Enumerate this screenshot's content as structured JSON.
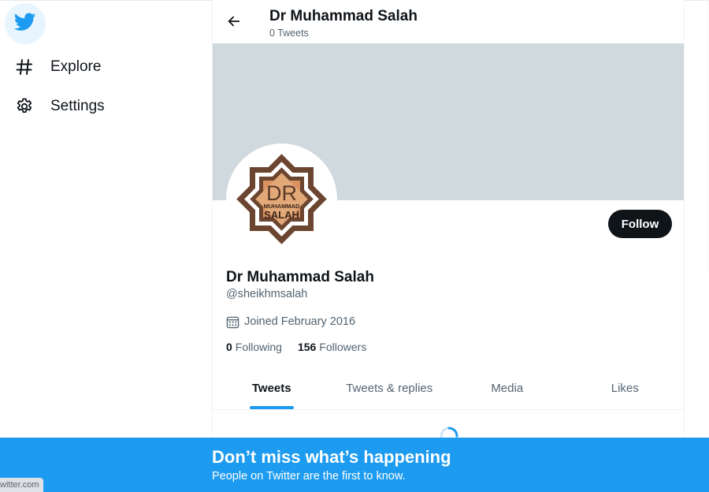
{
  "nav": {
    "logo_icon": "twitter-bird-icon",
    "items": [
      {
        "icon": "hashtag-icon",
        "label": "Explore"
      },
      {
        "icon": "gear-icon",
        "label": "Settings"
      }
    ]
  },
  "header": {
    "name": "Dr Muhammad Salah",
    "tweet_count": "0 Tweets"
  },
  "profile": {
    "display_name": "Dr Muhammad Salah",
    "handle": "@sheikhmsalah",
    "joined": "Joined February 2016",
    "following_count": "0",
    "following_label": "Following",
    "followers_count": "156",
    "followers_label": "Followers",
    "follow_label": "Follow",
    "avatar_text": {
      "line1": "DR",
      "line2": "MUHAMMAD",
      "line3": "SALAH"
    }
  },
  "tabs": [
    {
      "label": "Tweets",
      "active": true
    },
    {
      "label": "Tweets & replies",
      "active": false
    },
    {
      "label": "Media",
      "active": false
    },
    {
      "label": "Likes",
      "active": false
    }
  ],
  "bottom_bar": {
    "title": "Don’t miss what’s happening",
    "subtitle": "People on Twitter are the first to know."
  },
  "status_url": "witter.com",
  "colors": {
    "accent": "#1d9bf0",
    "banner": "#cfd9de",
    "follow_button": "#0f1419"
  }
}
